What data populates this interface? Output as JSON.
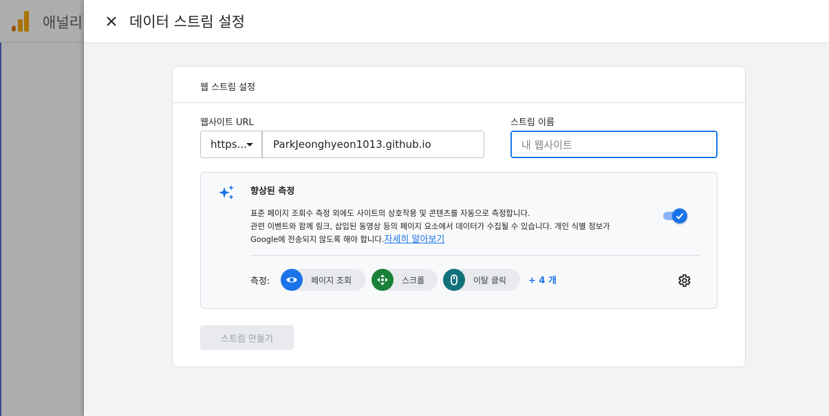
{
  "background": {
    "app_title": "애널리"
  },
  "panel": {
    "title": "데이터 스트림 설정"
  },
  "card": {
    "title": "웹 스트림 설정",
    "url_label": "웹사이트 URL",
    "protocol_value": "https...",
    "url_value": "ParkJeonghyeon1013.github.io",
    "name_label": "스트림 이름",
    "name_placeholder": "내 웹사이트"
  },
  "enhanced": {
    "title": "향상된 측정",
    "desc_line1": "표준 페이지 조회수 측정 외에도 사이트의 상호작용 및 콘텐츠를 자동으로 측정합니다.",
    "desc_line2": "관련 이벤트와 함께 링크, 삽입된 동영상 등의 페이지 요소에서 데이터가 수집될 수 있습니다. 개인 식별 정보가",
    "desc_line3": "Google에 전송되지 않도록 해야 합니다.",
    "learn_more": "자세히 알아보기",
    "toggle_on": true,
    "metrics_label": "측정:",
    "metrics": [
      {
        "label": "페이지 조회",
        "icon": "eye-icon",
        "color": "#1a73e8"
      },
      {
        "label": "스크롤",
        "icon": "scroll-icon",
        "color": "#188038"
      },
      {
        "label": "이탈 클릭",
        "icon": "mouse-icon",
        "color": "#12727c"
      }
    ],
    "more_count": "+ 4 개"
  },
  "create_button": "스트림 만들기",
  "colors": {
    "accent": "#1a73e8",
    "ga_orange": "#f9ab00",
    "ga_dark_orange": "#e37400"
  }
}
